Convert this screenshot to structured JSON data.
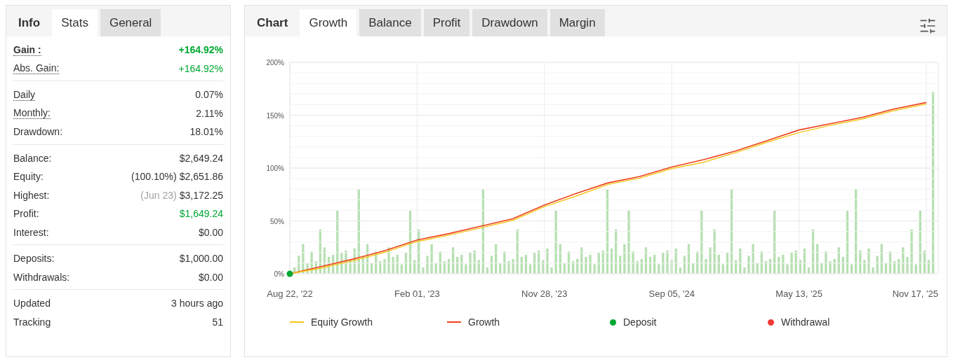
{
  "stats_panel": {
    "tabs": [
      {
        "label": "Info",
        "kind": "heading"
      },
      {
        "label": "Stats",
        "selected": true,
        "kind": "tab"
      },
      {
        "label": "General",
        "selected": false,
        "kind": "tab"
      }
    ],
    "groups": [
      [
        {
          "label": "Gain :",
          "value": "+164.92%",
          "underlined": true,
          "emphasis": true,
          "color": "#00a832"
        },
        {
          "label": "Abs. Gain:",
          "value": "+164.92%",
          "underlined": true,
          "emphasis": false,
          "color": "#00a832"
        }
      ],
      [
        {
          "label": "Daily",
          "value": "0.07%",
          "underlined": true,
          "emphasis": false,
          "color": "#333333"
        },
        {
          "label": "Monthly:",
          "value": "2.11%",
          "underlined": true,
          "emphasis": false,
          "color": "#333333"
        },
        {
          "label": "Drawdown:",
          "value": "18.01%",
          "underlined": false,
          "emphasis": false,
          "color": "#333333"
        }
      ],
      [
        {
          "label": "Balance:",
          "value": "$2,649.24",
          "underlined": false,
          "emphasis": false,
          "color": "#333333"
        },
        {
          "label": "Equity:",
          "note": {
            "text": "(100.10%)",
            "color": "#333333"
          },
          "value": "$2,651.86",
          "underlined": false,
          "emphasis": false,
          "color": "#333333"
        },
        {
          "label": "Highest:",
          "note": {
            "text": "(Jun 23)",
            "color": "#a0a0a0"
          },
          "value": "$3,172.25",
          "underlined": false,
          "emphasis": false,
          "color": "#333333"
        },
        {
          "label": "Profit:",
          "value": "$1,649.24",
          "underlined": false,
          "emphasis": false,
          "color": "#00a832"
        },
        {
          "label": "Interest:",
          "value": "$0.00",
          "underlined": false,
          "emphasis": false,
          "color": "#333333"
        }
      ],
      [
        {
          "label": "Deposits:",
          "value": "$1,000.00",
          "underlined": false,
          "emphasis": false,
          "color": "#333333"
        },
        {
          "label": "Withdrawals:",
          "value": "$0.00",
          "underlined": false,
          "emphasis": false,
          "color": "#333333"
        }
      ],
      [
        {
          "label": "Updated",
          "value": "3 hours ago",
          "underlined": false,
          "emphasis": false,
          "color": "#333333"
        },
        {
          "label": "Tracking",
          "value": "51",
          "underlined": false,
          "emphasis": false,
          "color": "#333333"
        }
      ]
    ]
  },
  "chart_panel": {
    "tabs": [
      {
        "label": "Chart",
        "kind": "heading"
      },
      {
        "label": "Growth",
        "selected": true,
        "kind": "tab"
      },
      {
        "label": "Balance",
        "selected": false,
        "kind": "tab"
      },
      {
        "label": "Profit",
        "selected": false,
        "kind": "tab"
      },
      {
        "label": "Drawdown",
        "selected": false,
        "kind": "tab"
      },
      {
        "label": "Margin",
        "selected": false,
        "kind": "tab"
      }
    ],
    "chart_data": {
      "type": "line",
      "categories": [
        "Aug 22, '22",
        null,
        null,
        null,
        "Feb 01, '23",
        null,
        null,
        null,
        "Nov 28, '23",
        null,
        null,
        null,
        "Sep 05, '24",
        null,
        null,
        null,
        "May 13, '25",
        null,
        null,
        null,
        "Nov 17, '25"
      ],
      "series": [
        {
          "name": "Equity Growth",
          "color": "#f5c518",
          "values": [
            0,
            5.5,
            12.5,
            20.5,
            30.5,
            36.5,
            43.5,
            50.5,
            63.5,
            73.5,
            84.5,
            90.5,
            99.5,
            105.5,
            114.5,
            124.5,
            133.5,
            140.5,
            146.5,
            154.5,
            160.5
          ]
        },
        {
          "name": "Growth",
          "color": "#f0421e",
          "values": [
            0,
            7,
            14,
            22,
            32,
            38,
            45,
            52,
            65,
            76,
            86,
            92,
            101,
            108,
            116,
            126,
            136,
            142,
            148,
            156,
            162
          ]
        }
      ],
      "ylim": [
        0,
        200
      ],
      "grid": true,
      "yticks": [
        {
          "value": 0,
          "label": "0%"
        },
        {
          "value": 50,
          "label": "50%"
        },
        {
          "value": 100,
          "label": "100%"
        },
        {
          "value": 150,
          "label": "150%"
        },
        {
          "value": 200,
          "label": "200%"
        }
      ]
    },
    "legend": [
      {
        "kind": "line"
      },
      {
        "kind": "line"
      },
      {
        "label": "Deposit",
        "kind": "dot",
        "color": "#00a832"
      },
      {
        "label": "Withdrawal",
        "kind": "dot",
        "color": "#ee3b33"
      }
    ]
  }
}
